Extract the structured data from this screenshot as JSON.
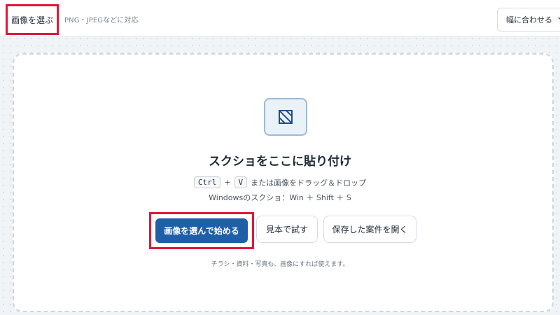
{
  "toolbar": {
    "choose_label": "画像を選ぶ",
    "format_hint": "PNG・JPEGなどに対応",
    "fit_select": {
      "value": "幅に合わせる",
      "icon": "chevron-down-icon"
    }
  },
  "dropzone": {
    "icon": "image-placeholder-icon",
    "title": "スクショをここに貼り付け",
    "shortcut": {
      "key1": "Ctrl",
      "plus": "+",
      "key2": "V",
      "text": "または画像をドラッグ＆ドロップ"
    },
    "windows_hint": "Windowsのスクショ：Win ＋ Shift ＋ S",
    "primary_button": "画像を選んで始める",
    "sample_button": "見本で試す",
    "open_button": "保存した案件を開く",
    "footnote": "チラシ・資料・写真も、画像にすれば使えます。"
  },
  "colors": {
    "accent": "#1f5fa8",
    "highlight": "#e0173a"
  }
}
